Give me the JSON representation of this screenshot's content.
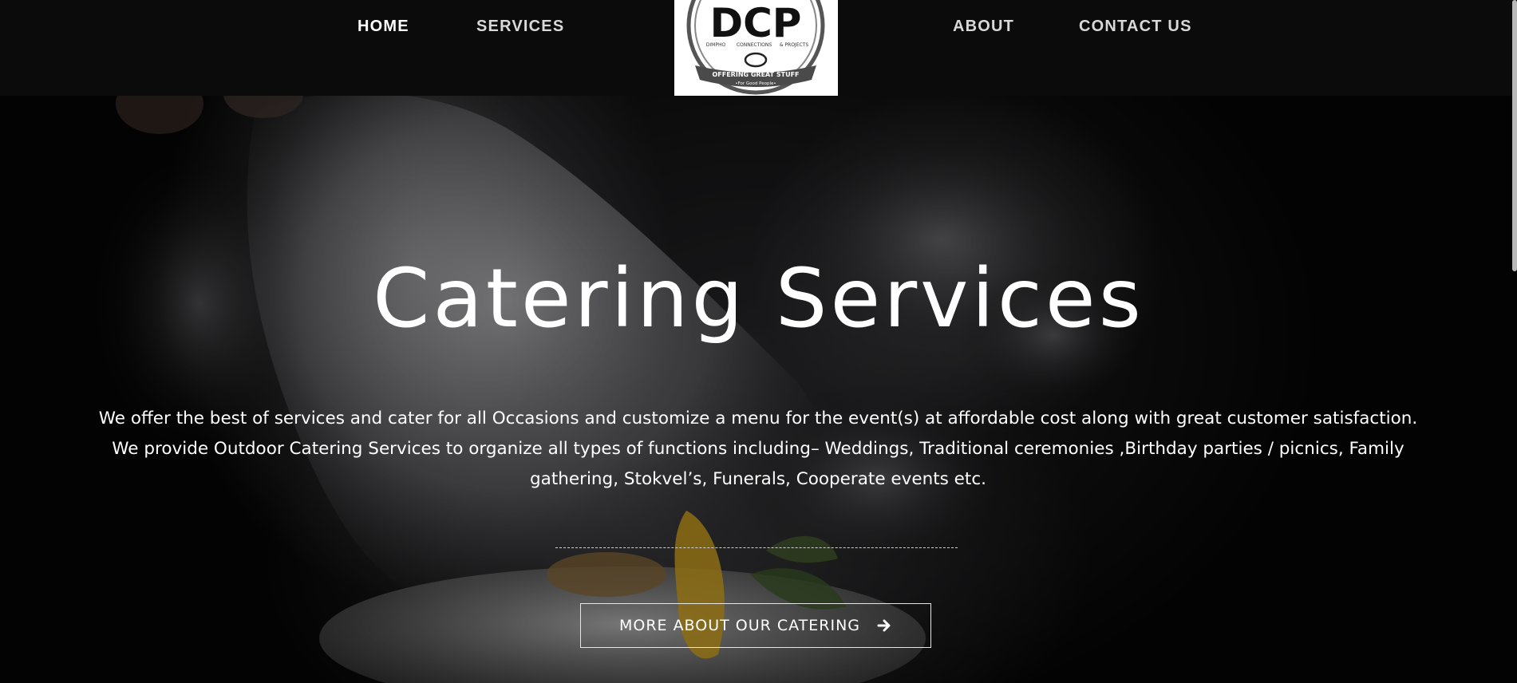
{
  "nav": {
    "items": [
      {
        "label": "HOME",
        "active": true
      },
      {
        "label": "SERVICES",
        "active": false
      },
      {
        "label": "ABOUT",
        "active": false
      },
      {
        "label": "CONTACT US",
        "active": false
      }
    ]
  },
  "logo": {
    "letters": "DCP",
    "sub_labels": [
      "DIMPHO",
      "CONNECTIONS",
      "& PROJECTS"
    ],
    "banner": "OFFERING GREAT STUFF",
    "tagline": "•For Good People•"
  },
  "hero": {
    "title": "Catering Services",
    "description": "We offer the best of services and cater for all Occasions and customize a menu for the event(s) at affordable cost along with great customer satisfaction. We provide Outdoor Catering Services to organize all types of functions including– Weddings, Traditional ceremonies ,Birthday parties / picnics, Family gathering, Stokvel’s, Funerals, Cooperate events etc.",
    "cta_label": "MORE ABOUT OUR CATERING",
    "cta_icon": "arrow-right-icon"
  },
  "colors": {
    "nav_bg": "#0b0b0b",
    "text": "#ffffff",
    "nav_text": "#d9d9d9"
  }
}
